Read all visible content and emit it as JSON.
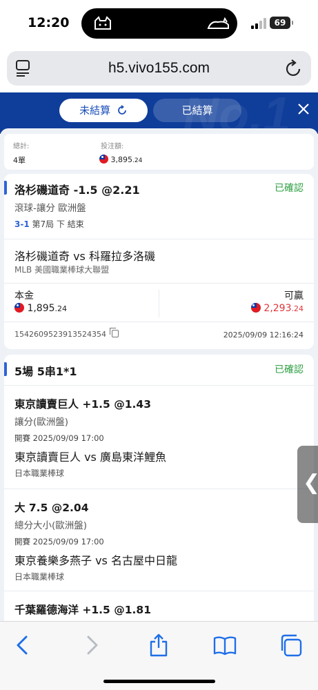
{
  "status_bar": {
    "time": "12:20",
    "battery": "69"
  },
  "browser": {
    "url": "h5.vivo155.com"
  },
  "header": {
    "tab_unsettled": "未結算",
    "tab_settled": "已結算"
  },
  "summary": {
    "total_label": "總計:",
    "total_value": "4單",
    "stake_label": "投注額:",
    "stake_main": "3,895",
    "stake_decimal": ".24"
  },
  "bet1": {
    "title": "洛杉磯道奇 -1.5 @2.21",
    "status": "已確認",
    "market": "滾球-讓分 歐洲盤",
    "score": "3-1",
    "inning": "第7局 下 結束",
    "match": "洛杉磯道奇 vs 科羅拉多洛磯",
    "league": "MLB 美國職業棒球大聯盟",
    "stake_label": "本金",
    "stake_main": "1,895",
    "stake_decimal": ".24",
    "win_label": "可贏",
    "win_main": "2,293",
    "win_decimal": ".24",
    "bet_id": "1542609523913524354",
    "bet_time": "2025/09/09 12:16:24"
  },
  "bet2": {
    "title": "5場 5串1*1",
    "status": "已確認",
    "legs": [
      {
        "pick": "東京讀賣巨人 +1.5 @1.43",
        "type": "讓分(歐洲盤)",
        "start": "開賽  2025/09/09 17:00",
        "match": "東京讀賣巨人 vs 廣島東洋鯉魚",
        "league": "日本職業棒球"
      },
      {
        "pick": "大 7.5 @2.04",
        "type": "總分大小(歐洲盤)",
        "start": "開賽  2025/09/09 17:00",
        "match": "東京養樂多燕子 vs 名古屋中日龍",
        "league": "日本職業棒球"
      },
      {
        "pick": "千葉羅德海洋 +1.5 @1.81"
      }
    ]
  },
  "colors": {
    "header_blue": "#0f3d9a",
    "accent_blue": "#2e63d6",
    "confirmed_green": "#2ea043",
    "win_red": "#e0343a"
  }
}
